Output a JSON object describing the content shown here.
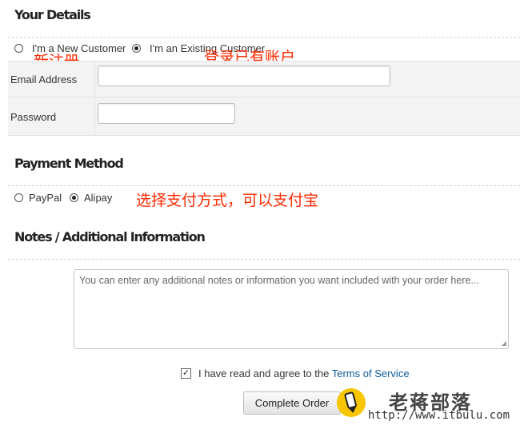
{
  "your_details": {
    "title": "Your Details",
    "new_customer_label": "I'm a New Customer",
    "existing_customer_label": "I'm an Existing Customer",
    "selected": "existing",
    "email_label": "Email Address",
    "email_value": "",
    "password_label": "Password",
    "password_value": ""
  },
  "payment": {
    "title": "Payment Method",
    "paypal_label": "PayPal",
    "alipay_label": "Alipay",
    "selected": "alipay"
  },
  "notes": {
    "title": "Notes / Additional Information",
    "placeholder": "You can enter any additional notes or information you want included with your order here..."
  },
  "terms": {
    "checked": true,
    "text": "I have read and agree to the",
    "link": "Terms of Service"
  },
  "complete_button": "Complete Order",
  "annotations": {
    "new_customer": "新注册",
    "existing_customer": "登录已有账户",
    "payment_hint": "选择支付方式，可以支付宝"
  },
  "watermark": {
    "name": "老蒋部落",
    "url": "http://www.itbulu.com"
  },
  "colors": {
    "link": "#0b5a9c",
    "annotation": "#ff2a00",
    "logo": "#f7c600"
  }
}
